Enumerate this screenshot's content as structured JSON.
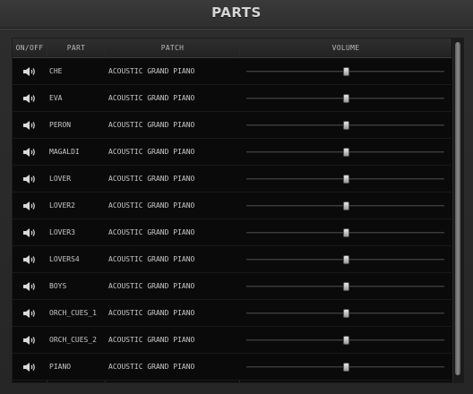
{
  "window": {
    "title": "PARTS"
  },
  "table": {
    "columns": {
      "onoff": "ON/OFF",
      "part": "PART",
      "patch": "PATCH",
      "volume": "VOLUME"
    },
    "rows": [
      {
        "part": "CHE",
        "patch": "ACOUSTIC GRAND PIANO",
        "volume": 0.5,
        "on": true
      },
      {
        "part": "EVA",
        "patch": "ACOUSTIC GRAND PIANO",
        "volume": 0.5,
        "on": true
      },
      {
        "part": "PERON",
        "patch": "ACOUSTIC GRAND PIANO",
        "volume": 0.5,
        "on": true
      },
      {
        "part": "MAGALDI",
        "patch": "ACOUSTIC GRAND PIANO",
        "volume": 0.5,
        "on": true
      },
      {
        "part": "LOVER",
        "patch": "ACOUSTIC GRAND PIANO",
        "volume": 0.5,
        "on": true
      },
      {
        "part": "LOVER2",
        "patch": "ACOUSTIC GRAND PIANO",
        "volume": 0.5,
        "on": true
      },
      {
        "part": "LOVER3",
        "patch": "ACOUSTIC GRAND PIANO",
        "volume": 0.5,
        "on": true
      },
      {
        "part": "LOVERS4",
        "patch": "ACOUSTIC GRAND PIANO",
        "volume": 0.5,
        "on": true
      },
      {
        "part": "BOYS",
        "patch": "ACOUSTIC GRAND PIANO",
        "volume": 0.5,
        "on": true
      },
      {
        "part": "ORCH_CUES_1",
        "patch": "ACOUSTIC GRAND PIANO",
        "volume": 0.5,
        "on": true
      },
      {
        "part": "ORCH_CUES_2",
        "patch": "ACOUSTIC GRAND PIANO",
        "volume": 0.5,
        "on": true
      },
      {
        "part": "PIANO",
        "patch": "ACOUSTIC GRAND PIANO",
        "volume": 0.5,
        "on": true
      }
    ]
  },
  "icons": {
    "onoff": "speaker-icon"
  }
}
